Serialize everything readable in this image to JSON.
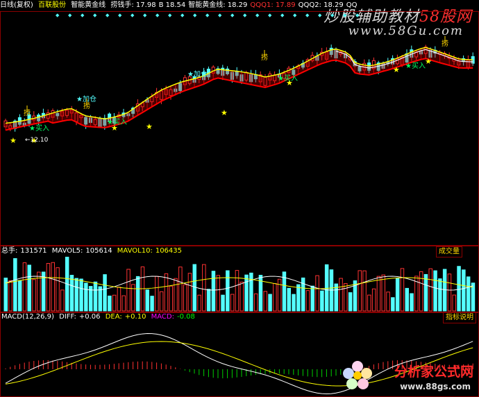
{
  "header": {
    "period": "日线(复权)",
    "stock_name": "百联股份",
    "indicator_name": "智能黄金线",
    "items": [
      {
        "label": "捞钱手:",
        "value": "17.98",
        "color": "#ffffff"
      },
      {
        "label": "B",
        "value": "18.54",
        "color": "#ffffff"
      },
      {
        "label": "智能黄金线:",
        "value": "18.29",
        "color": "#ffffff"
      },
      {
        "label": "QQQ1:",
        "value": "17.89",
        "color": "#ff3030"
      },
      {
        "label": "QQQ2:",
        "value": "18.29",
        "color": "#ffffff"
      },
      {
        "label": "QQ",
        "value": "",
        "color": "#ffffff"
      }
    ]
  },
  "main_chart": {
    "annotations": {
      "buy": "买入",
      "add": "加仓",
      "grab": "捞",
      "low_price": "12.10"
    }
  },
  "volume_panel": {
    "label": "总手:",
    "value": "131571",
    "mavol5_label": "MAVOL5:",
    "mavol5": "105614",
    "mavol10_label": "MAVOL10:",
    "mavol10": "106435",
    "button": "成交量"
  },
  "macd_panel": {
    "label": "MACD(12,26,9)",
    "diff_label": "DIFF:",
    "diff": "+0.06",
    "dea_label": "DEA:",
    "dea": "+0.10",
    "macd_label": "MACD:",
    "macd": "-0.08",
    "button": "指标说明"
  },
  "watermarks": {
    "top_a": "炒股辅助教材",
    "top_b": "58股网",
    "top_c": "www.58Gu.com",
    "bottom_a": "分析家公式网",
    "bottom_b": "www.88gs.com"
  },
  "colors": {
    "up": "#ff3232",
    "down": "#54ffff",
    "gold_line": "#ffff00",
    "red_line": "#ff0000",
    "border": "#8b0000",
    "star": "#ffff00",
    "buy_text": "#00ff60"
  },
  "chart_data": {
    "type": "candlestick",
    "bars": 100,
    "price_range": [
      12.1,
      21.5
    ],
    "volume_unit": "手",
    "macd_params": [
      12,
      26,
      9
    ]
  }
}
